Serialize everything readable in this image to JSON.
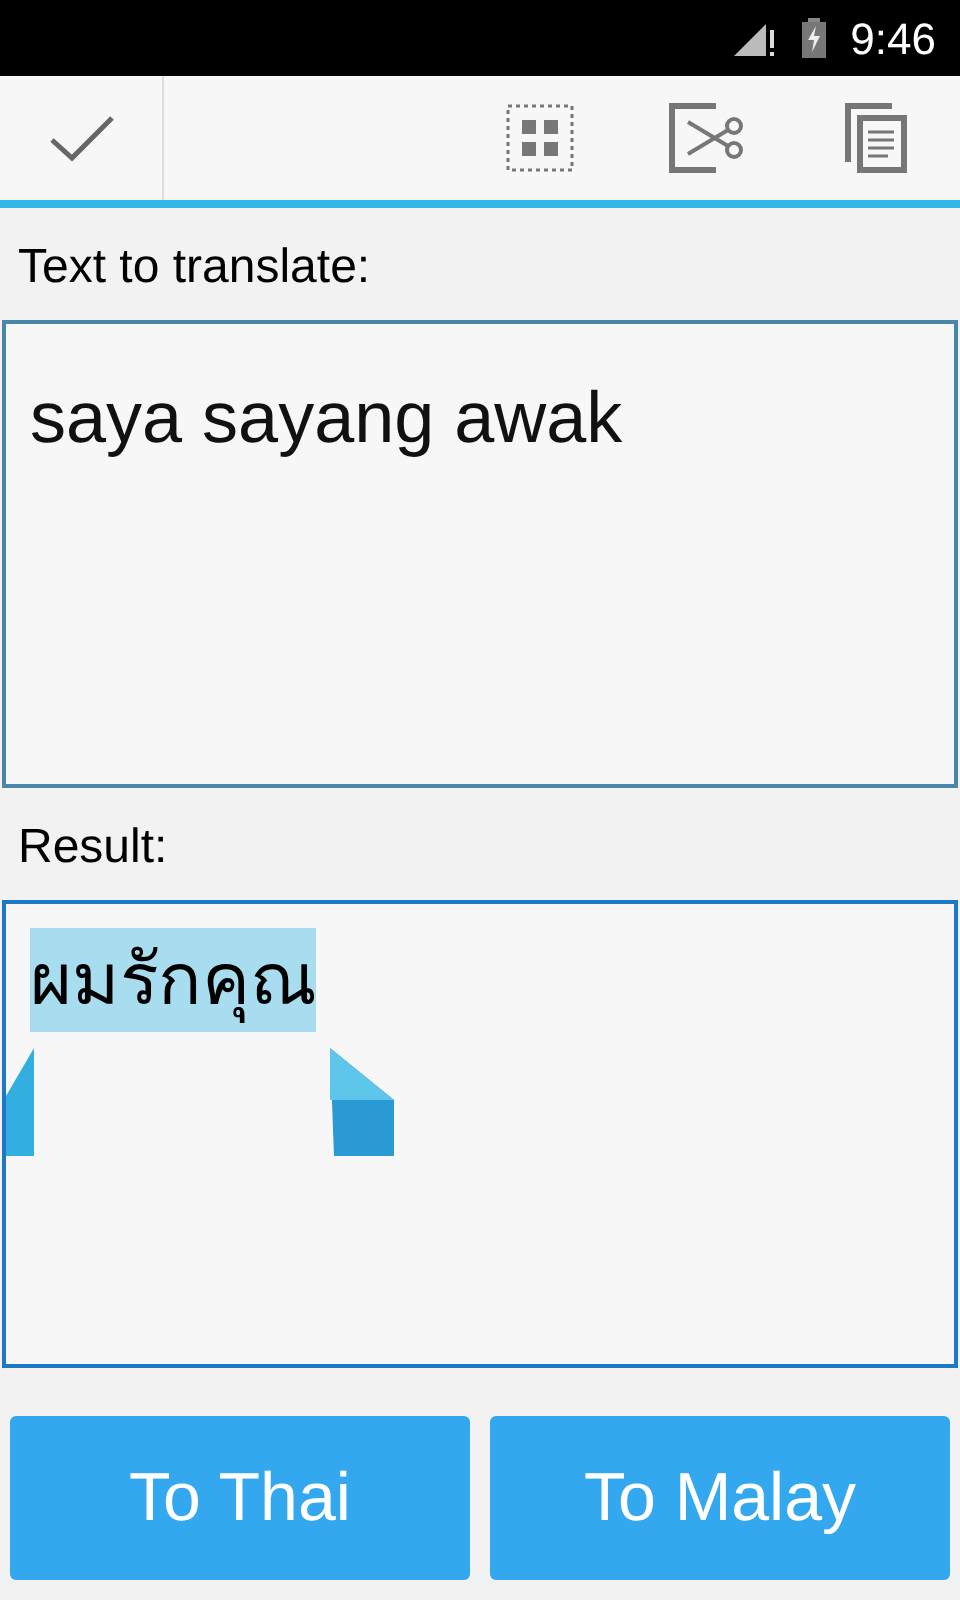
{
  "status_bar": {
    "time": "9:46"
  },
  "input": {
    "label": "Text to translate:",
    "value": "saya sayang awak"
  },
  "result": {
    "label": "Result:",
    "value": "ผมรักคุณ",
    "selected": true
  },
  "buttons": [
    {
      "label": "To Thai"
    },
    {
      "label": "To Malay"
    }
  ]
}
